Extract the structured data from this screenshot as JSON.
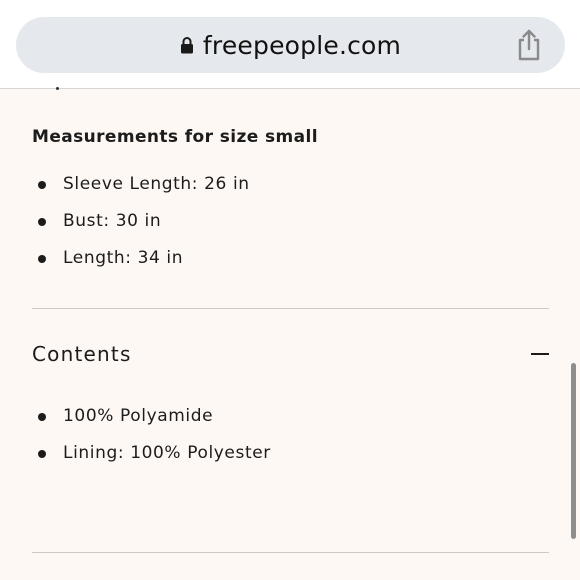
{
  "browser": {
    "url": "freepeople.com"
  },
  "measurements": {
    "title": "Measurements for size small",
    "items": [
      "Sleeve Length: 26 in",
      "Bust: 30 in",
      "Length: 34 in"
    ]
  },
  "contents": {
    "title": "Contents",
    "items": [
      "100% Polyamide",
      "Lining: 100% Polyester"
    ]
  },
  "icons": {
    "address_bar": "lock-icon",
    "share": "share-icon",
    "accordion_toggle": "minus-icon"
  }
}
